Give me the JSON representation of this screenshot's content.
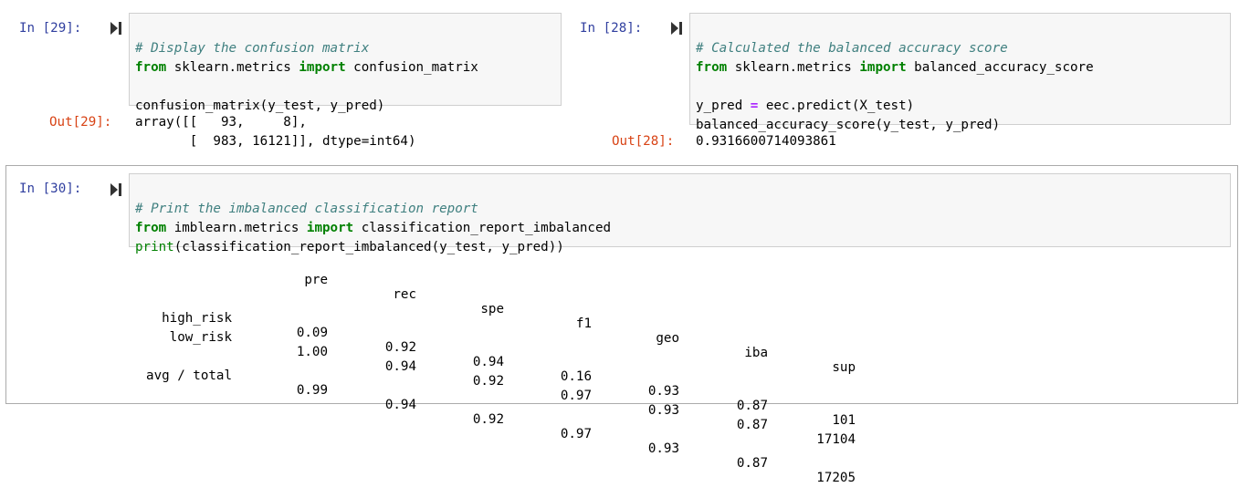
{
  "cell29": {
    "in_prompt": "In [29]:",
    "out_prompt": "Out[29]:",
    "code": {
      "comment": "# Display the confusion matrix",
      "from_kw": "from",
      "module": " sklearn.metrics ",
      "import_kw": "import",
      "import_name": " confusion_matrix",
      "call": "confusion_matrix(y_test, y_pred)"
    },
    "output_lines": [
      "array([[   93,     8],",
      "       [  983, 16121]], dtype=int64)"
    ]
  },
  "cell28": {
    "in_prompt": "In [28]:",
    "out_prompt": "Out[28]:",
    "code": {
      "comment": "# Calculated the balanced accuracy score",
      "from_kw": "from",
      "module": " sklearn.metrics ",
      "import_kw": "import",
      "import_name": " balanced_accuracy_score",
      "assign_lhs": "y_pred ",
      "assign_op": "=",
      "assign_rhs": " eec.predict(X_test)",
      "call": "balanced_accuracy_score(y_test, y_pred)"
    },
    "output": "0.9316600714093861"
  },
  "cell30": {
    "in_prompt": "In [30]:",
    "code": {
      "comment": "# Print the imbalanced classification report",
      "from_kw": "from",
      "module": " imblearn.metrics ",
      "import_kw": "import",
      "import_name": " classification_report_imbalanced",
      "print_kw": "print",
      "print_args": "(classification_report_imbalanced(y_test, y_pred))"
    },
    "report": {
      "headers": [
        "pre",
        "rec",
        "spe",
        "f1",
        "geo",
        "iba",
        "sup"
      ],
      "rows": [
        {
          "label": "high_risk",
          "values": [
            "0.09",
            "0.92",
            "0.94",
            "0.16",
            "0.93",
            "0.87",
            "101"
          ]
        },
        {
          "label": "low_risk",
          "values": [
            "1.00",
            "0.94",
            "0.92",
            "0.97",
            "0.93",
            "0.87",
            "17104"
          ]
        },
        {
          "label": "avg / total",
          "values": [
            "0.99",
            "0.94",
            "0.92",
            "0.97",
            "0.93",
            "0.87",
            "17205"
          ]
        }
      ]
    }
  },
  "colors": {
    "in_prompt": "#303f9f",
    "out_prompt": "#d84315",
    "keyword": "#008000",
    "comment": "#408080",
    "operator": "#aa22ff",
    "input_bg": "#f7f7f7"
  },
  "icons": {
    "run": "run-cell-icon"
  }
}
